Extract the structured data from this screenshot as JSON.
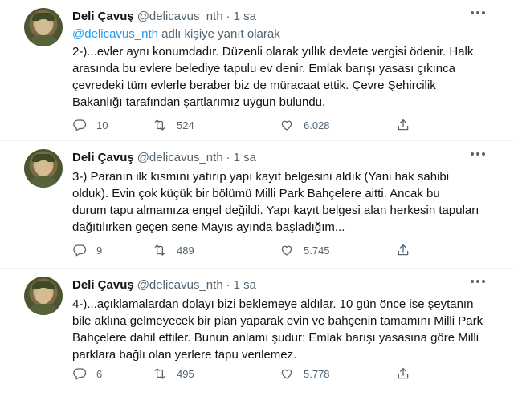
{
  "tweets": [
    {
      "author": "Deli Çavuş",
      "handle": "@delicavus_nth",
      "separator": "·",
      "time": "1 sa",
      "reply_mention": "@delicavus_nth",
      "reply_text": " adlı kişiye yanıt olarak",
      "text": "2-)...evler aynı konumdadır. Düzenli olarak yıllık devlete vergisi ödenir. Halk\narasında bu evlere belediye tapulu ev denir. Emlak barışı yasası çıkınca\nçevredeki tüm evlerle beraber biz de müracaat ettik. Çevre Şehircilik\nBakanlığı tarafından şartlarımız uygun bulundu.",
      "replies": "10",
      "retweets": "524",
      "likes": "6.028"
    },
    {
      "author": "Deli Çavuş",
      "handle": "@delicavus_nth",
      "separator": "·",
      "time": "1 sa",
      "text": "3-) Paranın ilk kısmını yatırıp yapı kayıt belgesini aldık (Yani hak sahibi\nolduk). Evin çok küçük bir bölümü Milli Park Bahçelere aitti. Ancak bu\ndurum tapu almamıza engel değildi. Yapı kayıt belgesi alan herkesin tapuları\ndağıtılırken geçen sene Mayıs ayında başladığım...",
      "replies": "9",
      "retweets": "489",
      "likes": "5.745"
    },
    {
      "author": "Deli Çavuş",
      "handle": "@delicavus_nth",
      "separator": "·",
      "time": "1 sa",
      "text": "4-)...açıklamalardan dolayı bizi beklemeye aldılar. 10 gün önce ise şeytanın\nbile aklına gelmeyecek bir plan yaparak evin ve bahçenin tamamını Milli Park\nBahçelere dahil ettiler. Bunun anlamı şudur: Emlak barışı yasasına göre Milli\nparklara bağlı olan yerlere tapu verilemez.",
      "replies": "6",
      "retweets": "495",
      "likes": "5.778"
    }
  ],
  "icons": {
    "reply": "reply-icon",
    "retweet": "retweet-icon",
    "like": "heart-icon",
    "share": "share-icon",
    "more": "more-icon"
  },
  "colors": {
    "link": "#1d9bf0",
    "secondary_text": "#536471",
    "primary_text": "#0f1419",
    "divider": "#eff3f4"
  }
}
